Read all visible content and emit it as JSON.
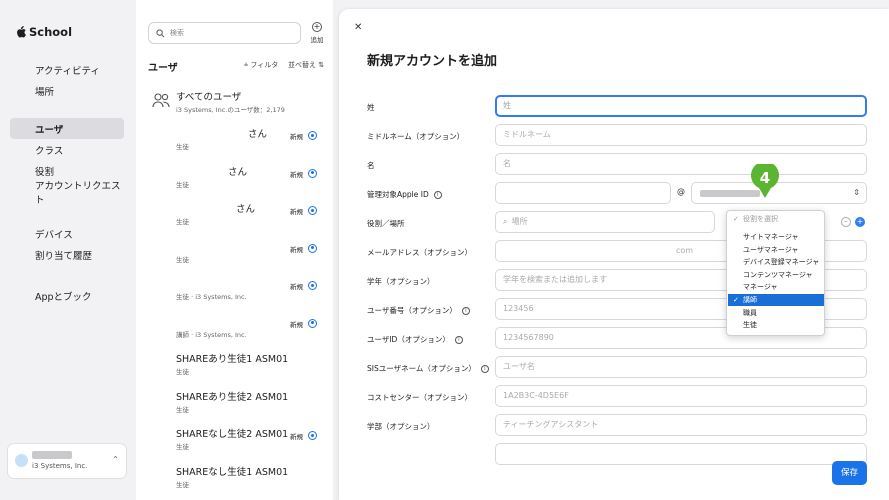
{
  "app": {
    "name": "School"
  },
  "sidebar": {
    "groups": [
      [
        {
          "label": "アクティビティ",
          "icon": "activity-icon"
        },
        {
          "label": "場所",
          "icon": "location-icon"
        }
      ],
      [
        {
          "label": "ユーザ",
          "icon": "users-icon",
          "active": true
        },
        {
          "label": "クラス",
          "icon": "class-icon"
        },
        {
          "label": "役割",
          "icon": "role-icon"
        },
        {
          "label": "アカウントリクエスト",
          "icon": "account-request-icon"
        }
      ],
      [
        {
          "label": "デバイス",
          "icon": "device-icon"
        },
        {
          "label": "割り当て履歴",
          "icon": "history-icon"
        }
      ],
      [
        {
          "label": "Appとブック",
          "icon": "apps-icon"
        }
      ]
    ],
    "org": {
      "subtitle": "i3 Systems, Inc."
    }
  },
  "userlist": {
    "search_placeholder": "検索",
    "add_label": "追加",
    "title": "ユーザ",
    "filter_label": "フィルタ",
    "sort_label": "並べ替え",
    "all_users": {
      "name": "すべてのユーザ",
      "sub": "i3 Systems, Inc.のユーザ数：2,179"
    },
    "rows": [
      {
        "name": "さん",
        "sub": "生徒",
        "badge": "新規",
        "selected": true
      },
      {
        "name": "さん",
        "sub": "生徒",
        "badge": "新規",
        "selected": true
      },
      {
        "name": "さん",
        "sub": "生徒",
        "badge": "新規",
        "selected": true
      },
      {
        "name": "",
        "sub": "生徒",
        "badge": "新規",
        "selected": true
      },
      {
        "name": "",
        "sub": "生徒 · i3 Systems, Inc.",
        "badge": "新規",
        "selected": true
      },
      {
        "name": "",
        "sub": "講師 · i3 Systems, Inc.",
        "badge": "新規",
        "selected": true
      },
      {
        "name": "SHAREあり生徒1 ASM01",
        "sub": "生徒",
        "badge": "",
        "selected": false
      },
      {
        "name": "SHAREあり生徒2 ASM01",
        "sub": "生徒",
        "badge": "",
        "selected": false
      },
      {
        "name": "SHAREなし生徒2 ASM01",
        "sub": "生徒",
        "badge": "新規",
        "selected": true
      },
      {
        "name": "SHAREなし生徒1 ASM01",
        "sub": "生徒",
        "badge": "",
        "selected": false
      }
    ]
  },
  "dialog": {
    "title": "新規アカウントを追加",
    "save_label": "保存",
    "fields": [
      {
        "label": "姓",
        "placeholder": "姓",
        "focused": true
      },
      {
        "label": "ミドルネーム（オプション）",
        "placeholder": "ミドルネーム"
      },
      {
        "label": "名",
        "placeholder": "名"
      },
      {
        "label": "管理対象Apple ID",
        "info": true,
        "placeholder": "",
        "at": "@",
        "domain_select": true
      },
      {
        "label": "役割／場所",
        "placeholder": "場所",
        "role_select": true
      },
      {
        "label": "メールアドレス（オプション）",
        "placeholder": "com"
      },
      {
        "label": "学年（オプション）",
        "placeholder": "学年を検索または追加します"
      },
      {
        "label": "ユーザ番号（オプション）",
        "info": true,
        "placeholder": "123456"
      },
      {
        "label": "ユーザID（オプション）",
        "info": true,
        "placeholder": "1234567890"
      },
      {
        "label": "SISユーザネーム（オプション）",
        "info": true,
        "placeholder": "ユーザ名"
      },
      {
        "label": "コストセンター（オプション）",
        "placeholder": "1A2B3C-4D5E6F"
      },
      {
        "label": "学部（オプション）",
        "placeholder": "ティーチングアシスタント"
      },
      {
        "label": "",
        "placeholder": ""
      }
    ]
  },
  "role_dropdown": {
    "placeholder": "役割を選択",
    "options": [
      "サイトマネージャ",
      "ユーザマネージャ",
      "デバイス登録マネージャ",
      "コンテンツマネージャ",
      "マネージャ",
      "講師",
      "職員",
      "生徒"
    ],
    "selected": "講師"
  },
  "step_marker": {
    "number": "4",
    "color": "#5cb531"
  },
  "colors": {
    "accent": "#1a73e8",
    "focus": "#2e7cf6"
  }
}
